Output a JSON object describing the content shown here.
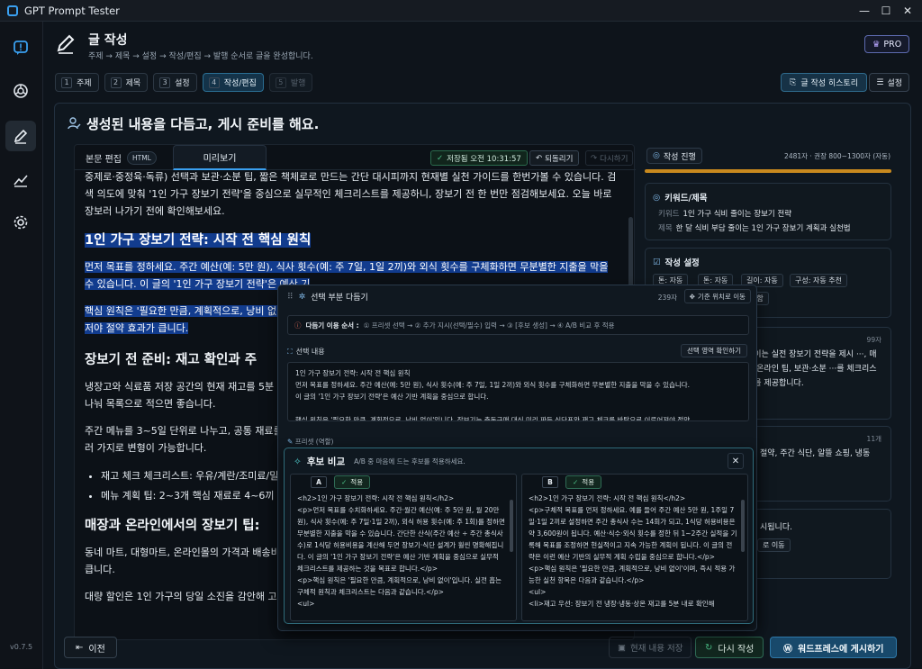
{
  "app": {
    "title": "GPT Prompt Tester",
    "version": "v0.7.5"
  },
  "header": {
    "title": "글 작성",
    "subtitle": "주제 → 제목 → 설정 → 작성/편집 → 발행 순서로 글을 완성합니다.",
    "pro_label": "PRO"
  },
  "steps": [
    {
      "num": "1",
      "label": "주제"
    },
    {
      "num": "2",
      "label": "제목"
    },
    {
      "num": "3",
      "label": "설정"
    },
    {
      "num": "4",
      "label": "작성/편집"
    },
    {
      "num": "5",
      "label": "발행"
    }
  ],
  "toolbar": {
    "history_label": "글 작성 히스토리",
    "settings_label": "설정"
  },
  "card": {
    "title": "생성된 내용을 다듬고, 게시 준비를 해요."
  },
  "editor": {
    "tab_edit": "본문 편집",
    "tab_edit_badge": "HTML",
    "tab_preview": "미리보기",
    "saved": "저장됨 오전 10:31:57",
    "undo": "되돌리기",
    "redo": "다시하기",
    "p0": "중제로·중정육·독류) 선택과 보관·소분 팁, 짧은 책체로로 만드는 간단 대시피까지 현재별 실천 가이드를 한번가볼 수 있습니다. 검색 의도에 맞춰 '1인 가구 장보기 전략'을 중심으로 실무적인 체크리스트를 제공하니, 장보기 전 한 번만 점검해보세요. 오늘 바로 장보러 나가기 전에 확인해보세요.",
    "h1": "1인 가구 장보기 전략: 시작 전 핵심 원칙",
    "p1": "먼저 목표를 정하세요. 주간 예산(예: 5만 원), 식사 횟수(예: 주 7일, 1일 2끼)와 외식 횟수를 구체화하면 무분별한 지출을 막을 수 있습니다. 이 글의 '1인 가구 장보기 전략'은 예산 기",
    "p2": "핵심 원칙은 '필요한 만큼, 계획적으로, 낭비 없이",
    "p2b": "저야 절약 효과가 큽니다.",
    "h2": "장보기 전 준비: 재고 확인과 주",
    "p3": "냉장고와 식료품 저장 공간의 현재 재고를 5분 내",
    "p3b": "나눠 목록으로 적으면 좋습니다.",
    "p4": "주간 메뉴를 3~5일 단위로 나누고, 공통 재료를 ",
    "p4b": "러 가지로 변형이 가능합니다.",
    "li1": "재고 체크 체크리스트: 우유/계란/조미료/밀",
    "li2": "메뉴 계획 팁: 2~3개 핵심 재료로 4~6끼 구",
    "h3": "매장과 온라인에서의 장보기 팁:",
    "p5": "동네 마트, 대형마트, 온라인몰의 가격과 배송비",
    "p5b": "큽니다.",
    "p6": "대량 할인은 1인 가구의 당일 소진을 감안해 고르세요"
  },
  "progress": {
    "label": "작성 진행",
    "count": "2481자 · 권장 800~1300자 (자동)",
    "fill_fraction": 1.0
  },
  "keywords": {
    "title": "키워드/제목",
    "kw_label": "키워드",
    "kw_value": "1인 가구 식비 줄이는 장보기 전략",
    "title_label": "제목",
    "title_value": "한 달 식비 부담 줄이는 1인 가구 장보기 계획과 실천법"
  },
  "settings": {
    "title": "작성 설정",
    "chip1": "톤: 자동",
    "chip2": "톤: 자동",
    "chip3": "길이: 자동",
    "chip4": "구성: 자동 추천",
    "chip5": "포함"
  },
  "summary_box": {
    "count": "99자",
    "text": "줄이는 실전 장보기 전략을 제시 ···, 매장·온라인 팁, 보관·소분 ···를 체크리스트를 제공합니다."
  },
  "keywords_box": {
    "count": "11개",
    "text": "절약, 주간 식단, 알뜰 쇼핑, 냉동"
  },
  "notice_box": {
    "text": "시됩니다.",
    "btn": "로 이동"
  },
  "footer": {
    "prev": "이전",
    "save": "현재 내용 저장",
    "rewrite": "다시 작성",
    "publish": "워드프레스에 게시하기"
  },
  "popup": {
    "title": "선택 부분 다듬기",
    "count": "239자",
    "move": "기준 위치로 이동",
    "steps_label": "다듬기 이용 순서 :",
    "steps_text": "① 프리셋 선택 → ② 추가 지시(선택/필수) 입력 → ③ [후보 생성] → ④ A/B 비교 후 적용",
    "sel_label": "선택 내용",
    "sel_btn": "선택 영역 확인하기",
    "sel_l1": "1인 가구 장보기 전략: 시작 전 핵심 원칙",
    "sel_l2": "먼저 목표를 정하세요. 주간 예산(예: 5만 원), 식사 횟수(예: 주 7일, 1일 2끼)와 외식 횟수를 구체화하면 무분별한 지출을 막을 수 있습니다.",
    "sel_l3": "이 글의 '1인 가구 장보기 전략'은 예산 기반 계획을 중심으로 합니다.",
    "sel_l4": "핵심 원칙은 '필요한 만큼, 계획적으로, 낭비 없이'입니다. 장보기는 충동구매 대신 미리 짜둔 식단표와 재고 체크를 바탕으로 이루어져야 절약",
    "preset_label": "프리셋 (역할)"
  },
  "compare": {
    "title": "후보 비교",
    "subtitle": "A/B 중 마음에 드는 후보를 적용하세요.",
    "close": "✕",
    "apply": "적용",
    "a_label": "A",
    "b_label": "B",
    "a_text": "<h2>1인 가구 장보기 전략: 시작 전 핵심 원칙</h2>\n<p>먼저 목표를 수치화하세요. 주간·월간 예산(예: 주 5만 원, 월 20만 원), 식사 횟수(예: 주 7일·1일 2끼), 외식 허용 횟수(예: 주 1회)를 정하면 무분별한 지출을 막을 수 있습니다. 간단한 산식(주간 예산 ÷ 주간 총식사 수)로 1식당 허용비용을 계산해 두면 장보기·식단 설계가 훨씬 명확해집니다. 이 글의 '1인 가구 장보기 전략'은 예산 기반 계획을 중심으로 실무적 체크리스트를 제공하는 것을 목표로 합니다.</p>\n<p>핵심 원칙은 '필요한 만큼, 계획적으로, 낭비 없이'입니다. 실전 흡는 구체적 원칙과 체크리스트는 다음과 같습니다.</p>\n<ul>",
    "b_text": "<h2>1인 가구 장보기 전략: 시작 전 핵심 원칙</h2>\n<p>구체적 목표를 먼저 정하세요. 예를 들어 주간 예산 5만 원, 1주일 7일·1일 2끼로 설정하면 주간 총식사 수는 14회가 되고, 1식당 허용비용은 약 3,600원이 됩니다. 예산·식수·외식 횟수를 정한 뒤 1~2주간 실적을 기록해 목표를 조정하면 현실적이고 지속 가능한 계획이 됩니다. 이 글의 전략은 이런 예산 기반의 실무적 계획 수립을 중심으로 합니다.</p>\n<p>핵심 원칙은 '필요한 만큼, 계획적으로, 낭비 없이'이며, 즉시 적용 가능한 실천 항목은 다음과 같습니다.</p>\n<ul>\n<li>재고 우선: 장보기 전 냉장·냉동·상온 재고를 5분 내로 확인해"
  },
  "colors": {
    "accent": "#3aa0f0",
    "selection": "#123c8e",
    "progress": "#c8891e",
    "publish": "#18496b",
    "apply": "#12271f"
  }
}
